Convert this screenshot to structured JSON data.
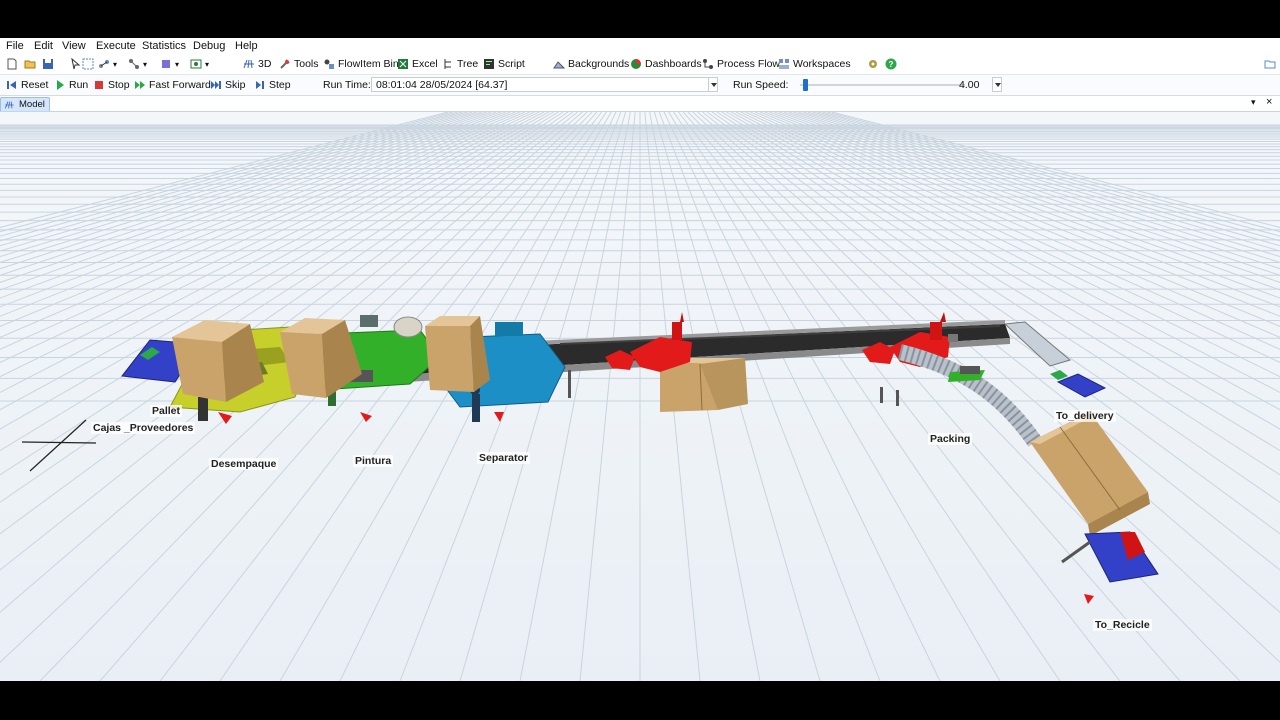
{
  "menu": [
    "File",
    "Edit",
    "View",
    "Execute",
    "Statistics",
    "Debug",
    "Help"
  ],
  "toolbar": {
    "btn_3d": "3D",
    "tools": "Tools",
    "flowitem_bin": "FlowItem Bin",
    "excel": "Excel",
    "tree": "Tree",
    "script": "Script",
    "backgrounds": "Backgrounds",
    "dashboards": "Dashboards",
    "process_flow": "Process Flow",
    "workspaces": "Workspaces"
  },
  "run_controls": {
    "reset": "Reset",
    "run": "Run",
    "stop": "Stop",
    "fast_forward": "Fast Forward",
    "skip": "Skip",
    "step": "Step",
    "run_time_label": "Run Time:",
    "run_time_value": "08:01:04  28/05/2024  [64.37]",
    "run_speed_label": "Run Speed:",
    "run_speed_value": "4.00",
    "run_speed_fraction": 0.02
  },
  "tab": {
    "label": "Model"
  },
  "model_labels": {
    "pallet": "Pallet",
    "cajas_proveedores": "Cajas _Proveedores",
    "desempaque": "Desempaque",
    "pintura": "Pintura",
    "separator": "Separator",
    "packing": "Packing",
    "to_delivery": "To_delivery",
    "to_recicle": "To_Recicle"
  },
  "colors": {
    "box": "#c9a36a",
    "robot": "#e21a1a",
    "desempaque_station": "#c7cf2a",
    "pintura_station": "#33b02a",
    "separator_station": "#1d8fc7",
    "sink": "#3340c8"
  }
}
